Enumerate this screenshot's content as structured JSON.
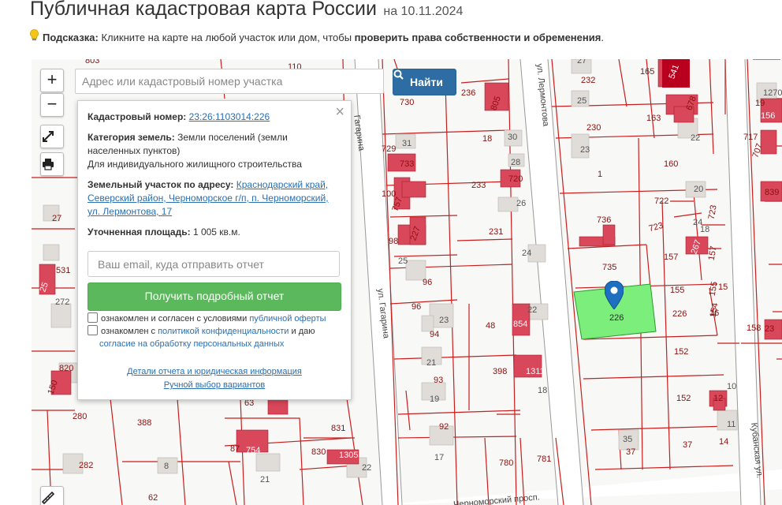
{
  "header": {
    "title": "Публичная кадастровая карта России",
    "date": "на 10.11.2024",
    "hint_label": "Подсказка:",
    "hint_text": " Кликните на карте на любой участок или дом, чтобы ",
    "hint_bold": "проверить права собственности и обременения",
    "hint_end": "."
  },
  "controls": {
    "zoom_in": "+",
    "zoom_out": "−",
    "search_placeholder": "Адрес или кадастровый номер участка",
    "search_button": "Найти"
  },
  "popup": {
    "close": "×",
    "cad_label": "Кадастровый номер:",
    "cad_value": "23:26:1103014:226",
    "category_label": "Категория земель:",
    "category_value": "Земли поселений (земли населенных пунктов)",
    "usage": "Для индивидуального жилищного строительства",
    "address_label": "Земельный участок по адресу:",
    "address_value": "Краснодарский край, Северский район, Черноморское г/п, п. Черноморский, ул. Лермонтова, 17",
    "area_label": "Уточненная площадь:",
    "area_value": "1 005 кв.м.",
    "email_placeholder": "Ваш email, куда отправить отчет",
    "report_button": "Получить подробный отчет",
    "consent1_text": "ознакомлен и согласен с условиями",
    "consent1_link": "публичной оферты",
    "consent2_text": "ознакомлен с",
    "consent2_link": "политикой конфиденциальности",
    "consent2_mid": "и даю",
    "consent2_link2": "согласие на обработку персональных данных",
    "details_link": "Детали отчета и юридическая информация",
    "manual_link": "Ручной выбор вариантов"
  },
  "map": {
    "streets": [
      "ул. Гагарина",
      "Гагарина",
      "ул. Лермонтова",
      "Черноморский просп.",
      "Кубанская ул."
    ],
    "selected_parcel": "226",
    "colors": {
      "parcel_line": "#c81e1e",
      "building": "#d9475a",
      "selected": "#7cee7c",
      "marker": "#1e6fc0"
    },
    "labels": [
      "803",
      "110",
      "730",
      "236",
      "805",
      "729",
      "31",
      "733",
      "100",
      "757",
      "98",
      "227",
      "25",
      "18",
      "30",
      "28",
      "720",
      "233",
      "26",
      "231",
      "24",
      "96",
      "96",
      "23",
      "94",
      "22",
      "48",
      "854",
      "21",
      "93",
      "398",
      "1311",
      "19",
      "18",
      "92",
      "17",
      "780",
      "781",
      "63",
      "87",
      "754",
      "830",
      "1305",
      "831",
      "22",
      "21",
      "8",
      "282",
      "280",
      "388",
      "62",
      "27",
      "232",
      "25",
      "230",
      "23",
      "1",
      "165",
      "541",
      "163",
      "678",
      "22",
      "160",
      "20",
      "722",
      "723",
      "24",
      "18",
      "736",
      "723",
      "1267",
      "157",
      "735",
      "157",
      "155",
      "155",
      "226",
      "155",
      "154",
      "152",
      "152",
      "12",
      "10",
      "11",
      "35",
      "37",
      "37",
      "14",
      "16",
      "15",
      "158",
      "19",
      "1270",
      "156",
      "717",
      "707",
      "839",
      "531",
      "25",
      "272",
      "27",
      "820",
      "150",
      "23"
    ]
  }
}
